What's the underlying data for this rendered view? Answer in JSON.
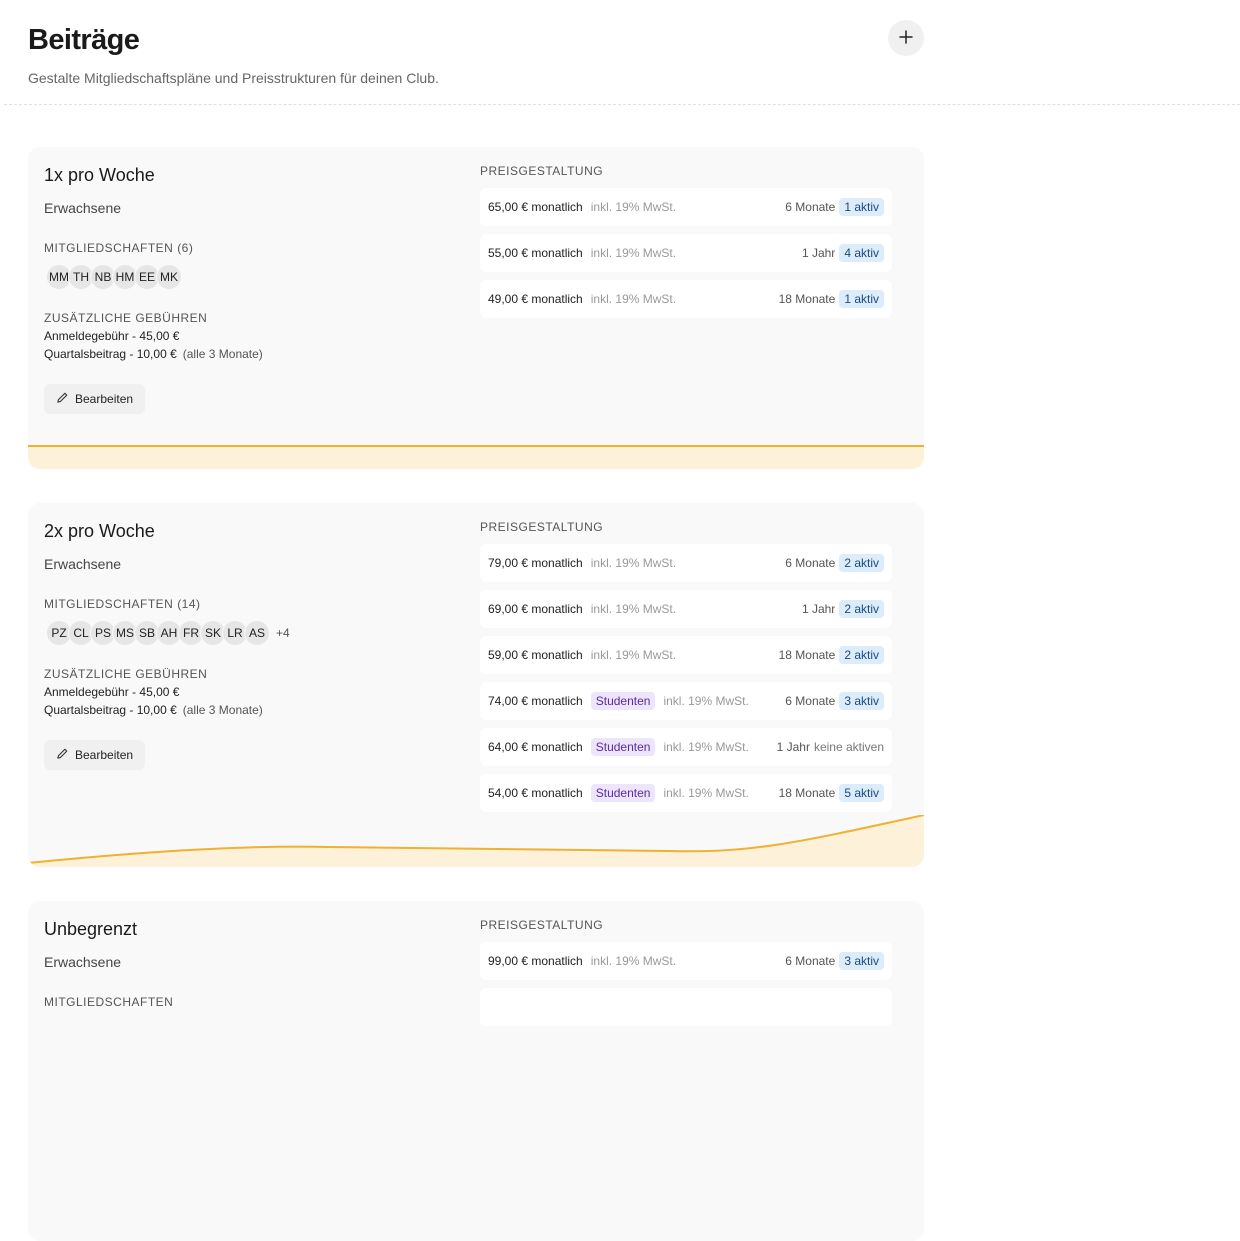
{
  "header": {
    "title": "Beiträge",
    "subtitle": "Gestalte Mitgliedschaftspläne und Preisstrukturen für deinen Club."
  },
  "labels": {
    "memberships": "Mitgliedschaften",
    "fees": "Zusätzliche Gebühren",
    "pricing": "Preisgestaltung",
    "edit": "Bearbeiten"
  },
  "icons": {
    "add": "plus-icon",
    "edit": "pencil-icon"
  },
  "colors": {
    "accent": "#f0b030",
    "active_badge_bg": "#dcecfb",
    "student_badge_bg": "#ede5fb"
  },
  "plans": [
    {
      "title": "1x pro Woche",
      "group": "Erwachsene",
      "members_count": "(6)",
      "avatars": [
        "MM",
        "TH",
        "NB",
        "HM",
        "EE",
        "MK"
      ],
      "avatars_more": "",
      "fees": [
        {
          "text": "Anmeldegebühr - 45,00 €",
          "note": ""
        },
        {
          "text": "Quartalsbeitrag - 10,00 €",
          "note": "(alle 3 Monate)"
        }
      ],
      "prices": [
        {
          "amount": "65,00 € monatlich",
          "tag": "",
          "vat": "inkl. 19% MwSt.",
          "duration": "6 Monate",
          "active": "1 aktiv"
        },
        {
          "amount": "55,00 € monatlich",
          "tag": "",
          "vat": "inkl. 19% MwSt.",
          "duration": "1 Jahr",
          "active": "4 aktiv"
        },
        {
          "amount": "49,00 € monatlich",
          "tag": "",
          "vat": "inkl. 19% MwSt.",
          "duration": "18 Monate",
          "active": "1 aktiv"
        }
      ]
    },
    {
      "title": "2x pro Woche",
      "group": "Erwachsene",
      "members_count": "(14)",
      "avatars": [
        "PZ",
        "CL",
        "PS",
        "MS",
        "SB",
        "AH",
        "FR",
        "SK",
        "LR",
        "AS"
      ],
      "avatars_more": "+4",
      "fees": [
        {
          "text": "Anmeldegebühr - 45,00 €",
          "note": ""
        },
        {
          "text": "Quartalsbeitrag - 10,00 €",
          "note": "(alle 3 Monate)"
        }
      ],
      "prices": [
        {
          "amount": "79,00 € monatlich",
          "tag": "",
          "vat": "inkl. 19% MwSt.",
          "duration": "6 Monate",
          "active": "2 aktiv"
        },
        {
          "amount": "69,00 € monatlich",
          "tag": "",
          "vat": "inkl. 19% MwSt.",
          "duration": "1 Jahr",
          "active": "2 aktiv"
        },
        {
          "amount": "59,00 € monatlich",
          "tag": "",
          "vat": "inkl. 19% MwSt.",
          "duration": "18 Monate",
          "active": "2 aktiv"
        },
        {
          "amount": "74,00 € monatlich",
          "tag": "Studenten",
          "vat": "inkl. 19% MwSt.",
          "duration": "6 Monate",
          "active": "3 aktiv"
        },
        {
          "amount": "64,00 € monatlich",
          "tag": "Studenten",
          "vat": "inkl. 19% MwSt.",
          "duration": "1 Jahr",
          "active": "keine aktiven"
        },
        {
          "amount": "54,00 € monatlich",
          "tag": "Studenten",
          "vat": "inkl. 19% MwSt.",
          "duration": "18 Monate",
          "active": "5 aktiv"
        }
      ]
    },
    {
      "title": "Unbegrenzt",
      "group": "Erwachsene",
      "members_count": "",
      "avatars": [],
      "avatars_more": "",
      "fees": [],
      "prices": [
        {
          "amount": "99,00 € monatlich",
          "tag": "",
          "vat": "inkl. 19% MwSt.",
          "duration": "6 Monate",
          "active": "3 aktiv"
        },
        {
          "amount": "",
          "tag": "",
          "vat": "",
          "duration": "",
          "active": ""
        }
      ]
    }
  ]
}
